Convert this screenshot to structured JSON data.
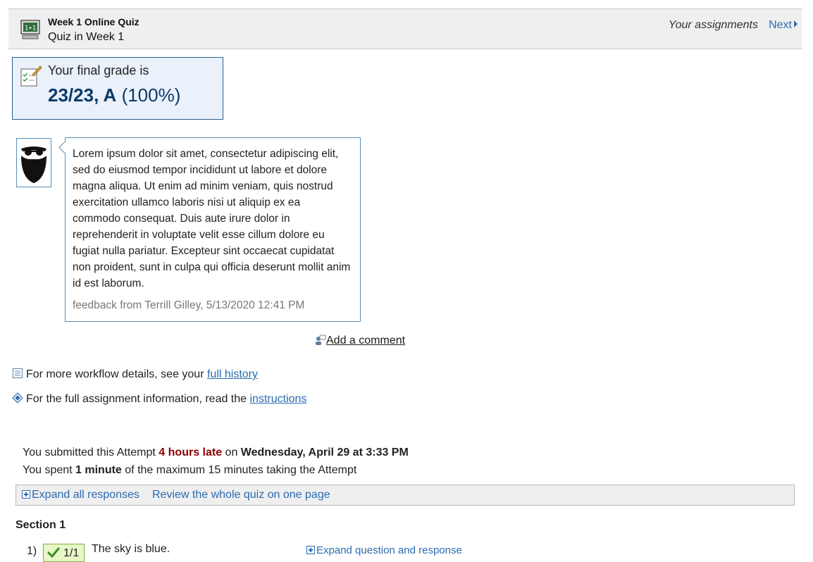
{
  "header": {
    "quiz_title": "Week 1 Online Quiz",
    "quiz_subtitle": "Quiz in Week 1",
    "your_assignments": "Your assignments",
    "next_label": "Next"
  },
  "grade": {
    "label": "Your final grade is",
    "score": "23/23, A",
    "percent": "(100%)"
  },
  "feedback": {
    "text": "Lorem ipsum dolor sit amet, consectetur adipiscing elit, sed do eiusmod tempor incididunt ut labore et dolore magna aliqua. Ut enim ad minim veniam, quis nostrud exercitation ullamco laboris nisi ut aliquip ex ea commodo consequat. Duis aute irure dolor in reprehenderit in voluptate velit esse cillum dolore eu fugiat nulla pariatur. Excepteur sint occaecat cupidatat non proident, sunt in culpa qui officia deserunt mollit anim id est laborum.",
    "meta": "feedback from Terrill Gilley, 5/13/2020 12:41 PM",
    "add_comment": "Add a comment"
  },
  "links": {
    "history_prefix": "For more workflow details, see your ",
    "history_link": "full history",
    "instructions_prefix": "For the full assignment information, read the ",
    "instructions_link": "instructions"
  },
  "submission": {
    "prefix": "You submitted this Attempt ",
    "late": "4 hours late",
    "on": " on ",
    "date": "Wednesday, April 29 at 3:33 PM",
    "spent_prefix": "You spent ",
    "spent_value": "1 minute",
    "spent_suffix": " of the maximum 15 minutes taking the Attempt"
  },
  "toolbar": {
    "expand_all": "Expand all responses",
    "review_whole": "Review the whole quiz on one page"
  },
  "section": {
    "title": "Section 1",
    "questions": [
      {
        "number": "1)",
        "score": "1/1",
        "text": "The sky is blue.",
        "expand": "Expand question and response"
      }
    ]
  },
  "colors": {
    "link": "#2b6cb0",
    "late": "#8b0000",
    "grade_text": "#0d3a66",
    "score_bg": "#e8f6c8"
  }
}
